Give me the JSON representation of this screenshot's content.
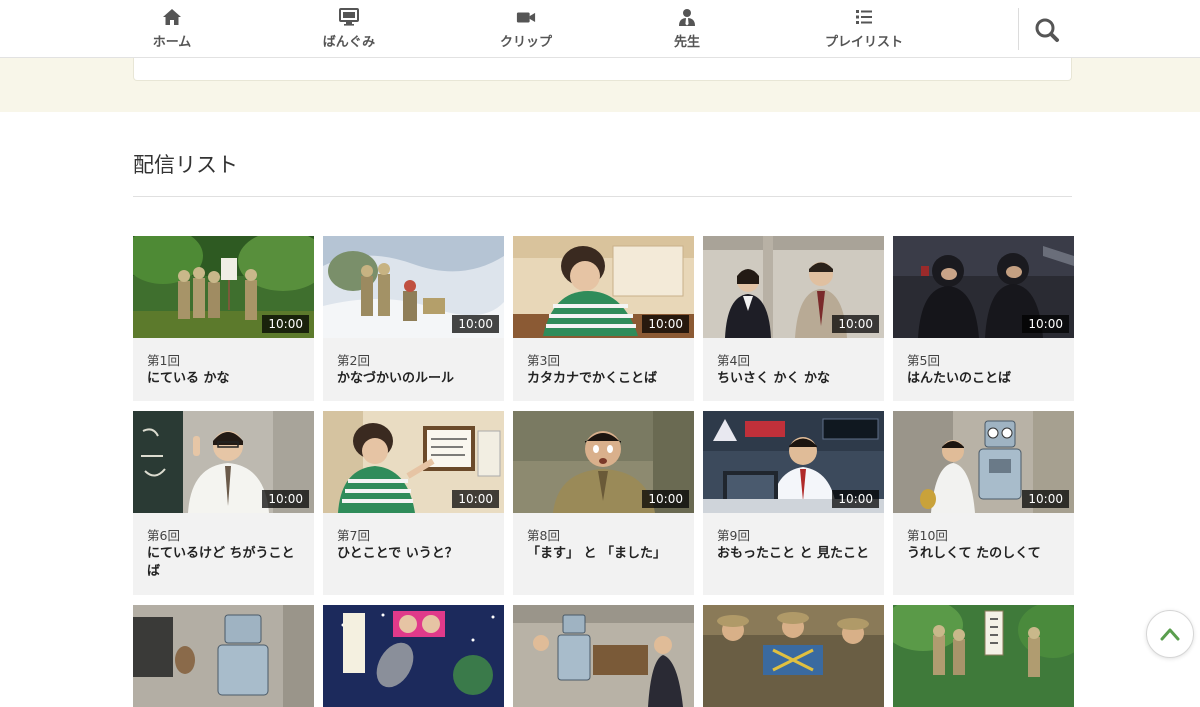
{
  "nav": {
    "home": "ホーム",
    "programs": "ばんぐみ",
    "clips": "クリップ",
    "teachers": "先生",
    "playlists": "プレイリスト"
  },
  "section": {
    "title": "配信リスト"
  },
  "episodes": [
    {
      "episode": "第1回",
      "title": "にている かな",
      "duration": "10:00"
    },
    {
      "episode": "第2回",
      "title": "かなづかいのルール",
      "duration": "10:00"
    },
    {
      "episode": "第3回",
      "title": "カタカナでかくことば",
      "duration": "10:00"
    },
    {
      "episode": "第4回",
      "title": "ちいさく かく かな",
      "duration": "10:00"
    },
    {
      "episode": "第5回",
      "title": "はんたいのことば",
      "duration": "10:00"
    },
    {
      "episode": "第6回",
      "title": "にているけど ちがうことば",
      "duration": "10:00"
    },
    {
      "episode": "第7回",
      "title": "ひとことで いうと？",
      "duration": "10:00"
    },
    {
      "episode": "第8回",
      "title": "「ます」 と 「ました」",
      "duration": "10:00"
    },
    {
      "episode": "第9回",
      "title": "おもったこと と 見たこと",
      "duration": "10:00"
    },
    {
      "episode": "第10回",
      "title": "うれしくて たのしくて",
      "duration": "10:00"
    }
  ],
  "colors": {
    "accent": "#5a9e4e",
    "band": "#f8f6e9",
    "card": "#f2f2f2"
  },
  "icons": {
    "home": "home-icon",
    "programs": "tv-icon",
    "clips": "video-camera-icon",
    "teachers": "teacher-icon",
    "playlists": "list-icon",
    "search": "search-icon",
    "to_top": "chevron-up-icon"
  }
}
